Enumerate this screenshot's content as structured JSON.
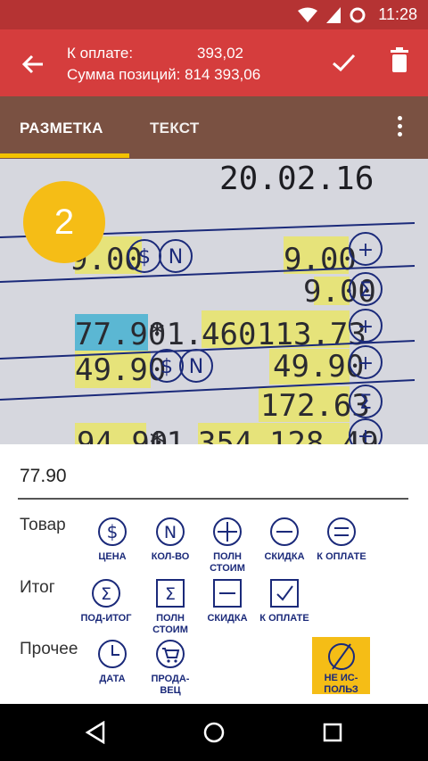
{
  "status": {
    "time": "11:28"
  },
  "header": {
    "due_label": "К оплате:",
    "due_value": "393,02",
    "items_sum_label": "Сумма позиций:",
    "items_sum_value": "814 393,06"
  },
  "tabs": [
    {
      "label": "РАЗМЕТКА",
      "active": true
    },
    {
      "label": "ТЕКСТ",
      "active": false
    }
  ],
  "receipt": {
    "badge": "2",
    "date": "20.02.16",
    "lines": [
      "9.00",
      "9.00",
      "9.00",
      "77.90",
      "*1.",
      "460",
      "113.73",
      "49.90",
      "49.90",
      "172.63",
      "94.90",
      "*1",
      "354",
      "128.49"
    ]
  },
  "selected_value": "77.90",
  "groups": {
    "goods": {
      "label": "Товар",
      "buttons": [
        {
          "icon": "dollar-circle-icon",
          "label": "ЦЕНА"
        },
        {
          "icon": "n-circle-icon",
          "label": "КОЛ-ВО"
        },
        {
          "icon": "plus-circle-icon",
          "label": "ПОЛН\nСТОИМ"
        },
        {
          "icon": "minus-circle-icon",
          "label": "СКИДКА"
        },
        {
          "icon": "equals-circle-icon",
          "label": "К ОПЛАТЕ"
        }
      ]
    },
    "total": {
      "label": "Итог",
      "buttons": [
        {
          "icon": "sigma-circle-icon",
          "label": "ПОД-ИТОГ"
        },
        {
          "icon": "sigma-square-icon",
          "label": "ПОЛН\nСТОИМ"
        },
        {
          "icon": "minus-square-icon",
          "label": "СКИДКА"
        },
        {
          "icon": "check-square-icon",
          "label": "К ОПЛАТЕ"
        }
      ]
    },
    "other": {
      "label": "Прочее",
      "buttons": [
        {
          "icon": "clock-icon",
          "label": "ДАТА"
        },
        {
          "icon": "cart-icon",
          "label": "ПРОДА-\nВЕЦ"
        }
      ],
      "unused_label": "НЕ ИС-\nПОЛЬЗ"
    }
  },
  "colors": {
    "statusbar": "#b53333",
    "appbar": "#d53d3d",
    "tabs": "#7a5142",
    "accent": "#f2c200",
    "badge": "#f5bd16",
    "ink": "#1b2a7a",
    "highlight_yellow": "#e6e37a",
    "highlight_blue": "#5bb7d3"
  }
}
